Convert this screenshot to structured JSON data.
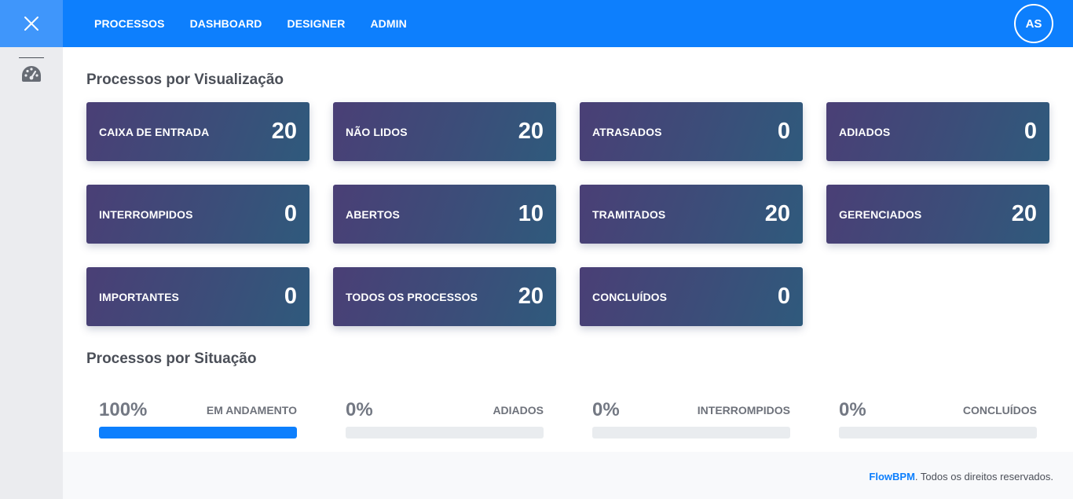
{
  "nav": {
    "items": [
      {
        "label": "PROCESSOS"
      },
      {
        "label": "DASHBOARD"
      },
      {
        "label": "DESIGNER"
      },
      {
        "label": "ADMIN"
      }
    ],
    "avatar_initials": "AS",
    "close_icon": "close-icon",
    "sidebar_icon": "dashboard-gauge-icon"
  },
  "visualizacao": {
    "title": "Processos por Visualização",
    "cards": [
      {
        "label": "CAIXA DE ENTRADA",
        "value": "20"
      },
      {
        "label": "NÃO LIDOS",
        "value": "20"
      },
      {
        "label": "ATRASADOS",
        "value": "0"
      },
      {
        "label": "ADIADOS",
        "value": "0"
      },
      {
        "label": "INTERROMPIDOS",
        "value": "0"
      },
      {
        "label": "ABERTOS",
        "value": "10"
      },
      {
        "label": "TRAMITADOS",
        "value": "20"
      },
      {
        "label": "GERENCIADOS",
        "value": "20"
      },
      {
        "label": "IMPORTANTES",
        "value": "0"
      },
      {
        "label": "TODOS OS PROCESSOS",
        "value": "20"
      },
      {
        "label": "CONCLUÍDOS",
        "value": "0"
      }
    ]
  },
  "situacao": {
    "title": "Processos por Situação",
    "items": [
      {
        "percent": "100%",
        "label": "EM ANDAMENTO",
        "fill": 1.0
      },
      {
        "percent": "0%",
        "label": "ADIADOS",
        "fill": 0
      },
      {
        "percent": "0%",
        "label": "INTERROMPIDOS",
        "fill": 0
      },
      {
        "percent": "0%",
        "label": "CONCLUÍDOS",
        "fill": 0
      }
    ]
  },
  "footer": {
    "brand": "FlowBPM",
    "text": ". Todos os direitos reservados."
  },
  "colors": {
    "primary": "#0d7ffd",
    "card_gradient_start": "#4a3f76",
    "card_gradient_end": "#2f5a7c"
  }
}
